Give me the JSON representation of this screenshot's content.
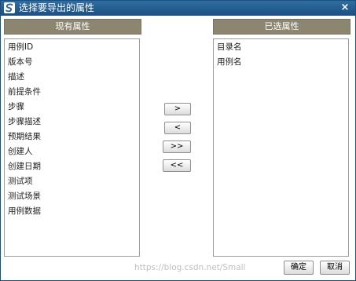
{
  "dialog": {
    "title": "选择要导出的属性",
    "close_label": "×"
  },
  "available": {
    "header": "现有属性",
    "items": [
      "用例ID",
      "版本号",
      "描述",
      "前提条件",
      "步骤",
      "步骤描述",
      "预期结果",
      "创建人",
      "创建日期",
      "测试项",
      "测试场景",
      "用例数据"
    ]
  },
  "selected": {
    "header": "已选属性",
    "items": [
      "目录名",
      "用例名"
    ]
  },
  "controls": {
    "move_right": ">",
    "move_left": "<",
    "move_all_right": ">>",
    "move_all_left": "<<"
  },
  "footer": {
    "ok_label": "确定",
    "cancel_label": "取消"
  },
  "watermark": "https://blog.csdn.net/Small"
}
